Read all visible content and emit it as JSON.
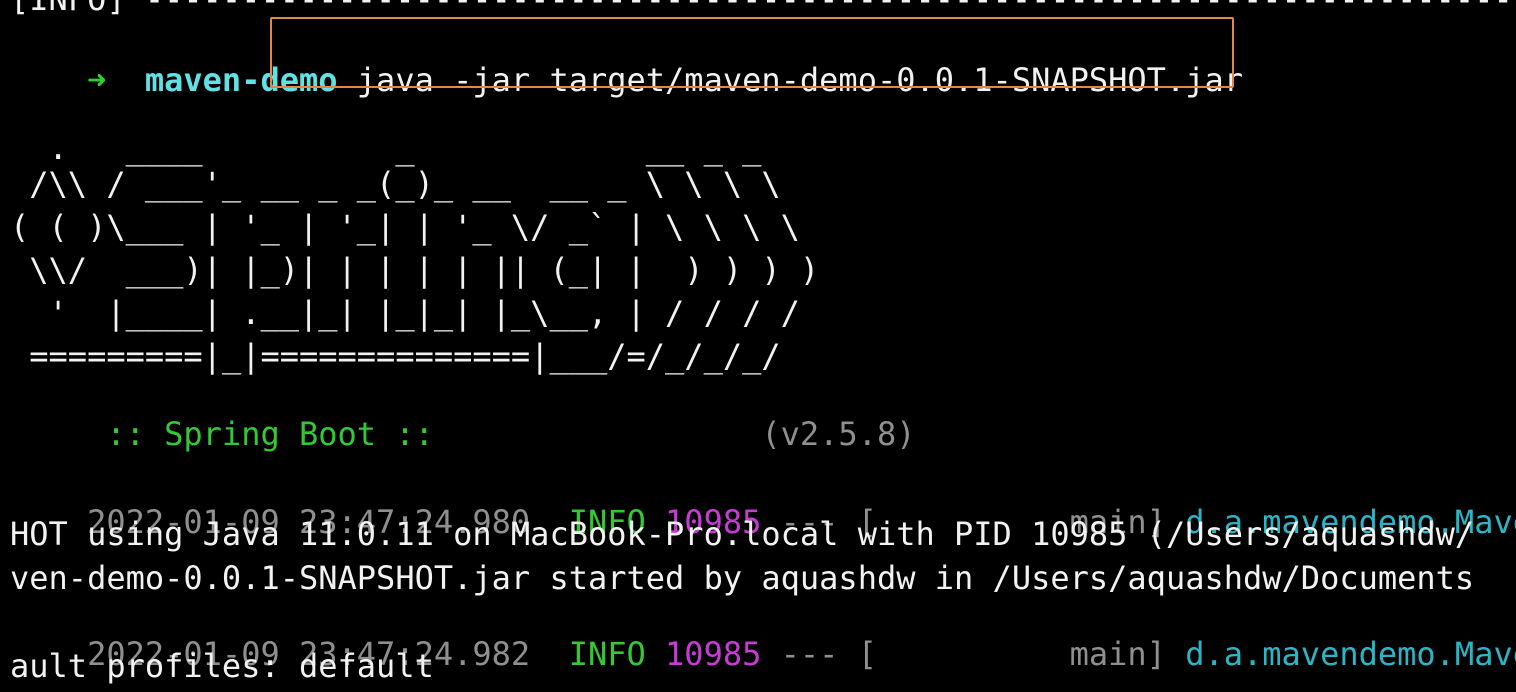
{
  "terminal": {
    "top_line": "[INFO] ----------------------------------------------------------------------------------",
    "prompt": {
      "arrow": "➜",
      "directory": "maven-demo",
      "command": "java -jar target/maven-demo-0.0.1-SNAPSHOT.jar"
    },
    "banner": [
      "  .   ____          _            __ _ _",
      " /\\\\ / ___'_ __ _ _(_)_ __  __ _ \\ \\ \\ \\",
      "( ( )\\___ | '_ | '_| | '_ \\/ _` | \\ \\ \\ \\",
      " \\\\/  ___)| |_)| | | | | || (_| |  ) ) ) )",
      "  '  |____| .__|_| |_|_| |_\\__, | / / / /",
      " =========|_|==============|___/=/_/_/_/"
    ],
    "spring_label": " :: Spring Boot ::",
    "spring_version": "(v2.5.8)",
    "logs": [
      {
        "timestamp": "2022-01-09 23:47:24.980",
        "level": "INFO",
        "pid": "10985",
        "sep": "--- [",
        "thread": "main]",
        "logger": "d.a.mavendemo.Mave"
      },
      {
        "timestamp": "2022-01-09 23:47:24.982",
        "level": "INFO",
        "pid": "10985",
        "sep": "--- [",
        "thread": "main]",
        "logger": "d.a.mavendemo.Mave"
      }
    ],
    "continuation_1": "HOT using Java 11.0.11 on MacBook-Pro.local with PID 10985 (/Users/aquashdw/",
    "continuation_2": "ven-demo-0.0.1-SNAPSHOT.jar started by aquashdw in /Users/aquashdw/Documents",
    "continuation_3": "ault profiles: default",
    "colors": {
      "highlight_box": "#e0874d",
      "prompt_arrow": "#2fd12f",
      "prompt_dir": "#5fe1e6",
      "info_level": "#34c934",
      "pid": "#c93ad6",
      "logger": "#2ab6c6",
      "dim_text": "#8f8f8f"
    }
  }
}
